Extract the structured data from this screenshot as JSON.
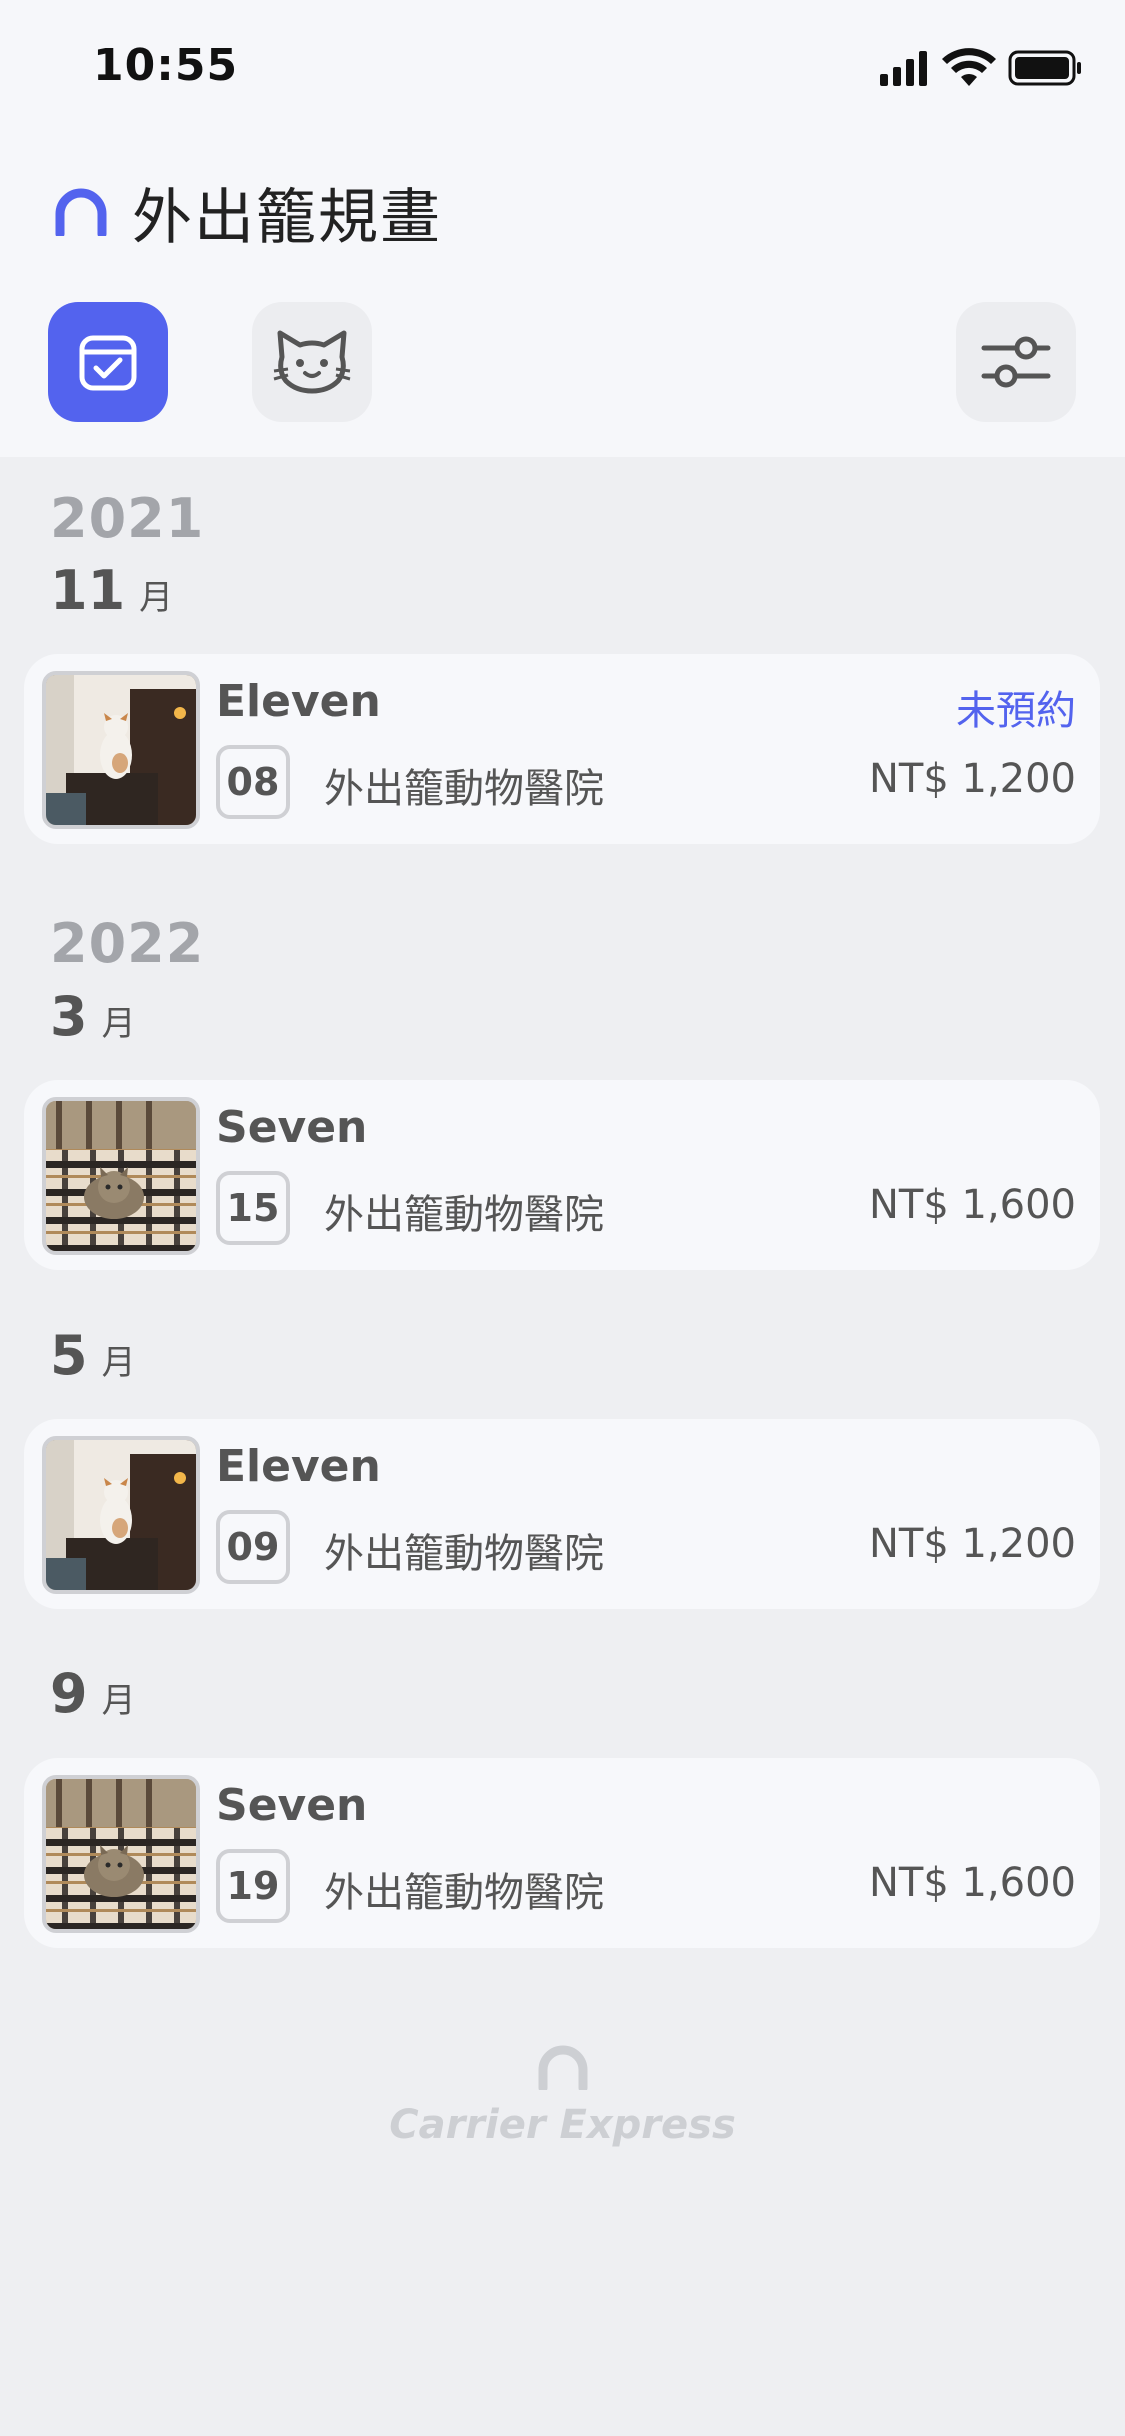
{
  "status_bar": {
    "time": "10:55"
  },
  "header": {
    "logo_icon": "arch-logo-icon",
    "title": "外出籠規畫",
    "accent_color": "#5363EE",
    "toolbar": {
      "plan_icon": "calendar-check-icon",
      "cat_icon": "cat-face-icon",
      "filter_icon": "sliders-icon"
    }
  },
  "groups": [
    {
      "year": "2021",
      "months": [
        {
          "month": "11",
          "suffix": "月",
          "entries": [
            {
              "pet": "Eleven",
              "status": "未預約",
              "day": "08",
              "clinic": "外出籠動物醫院",
              "price": "NT$ 1,200",
              "photo": "white-cat-photo"
            }
          ]
        }
      ]
    },
    {
      "year": "2022",
      "months": [
        {
          "month": "3",
          "suffix": "月",
          "entries": [
            {
              "pet": "Seven",
              "status": "",
              "day": "15",
              "clinic": "外出籠動物醫院",
              "price": "NT$ 1,600",
              "photo": "tabby-cat-photo"
            }
          ]
        },
        {
          "month": "5",
          "suffix": "月",
          "entries": [
            {
              "pet": "Eleven",
              "status": "",
              "day": "09",
              "clinic": "外出籠動物醫院",
              "price": "NT$ 1,200",
              "photo": "white-cat-photo"
            }
          ]
        },
        {
          "month": "9",
          "suffix": "月",
          "entries": [
            {
              "pet": "Seven",
              "status": "",
              "day": "19",
              "clinic": "外出籠動物醫院",
              "price": "NT$ 1,600",
              "photo": "tabby-cat-photo"
            }
          ]
        }
      ]
    }
  ],
  "footer": {
    "brand": "Carrier Express"
  }
}
